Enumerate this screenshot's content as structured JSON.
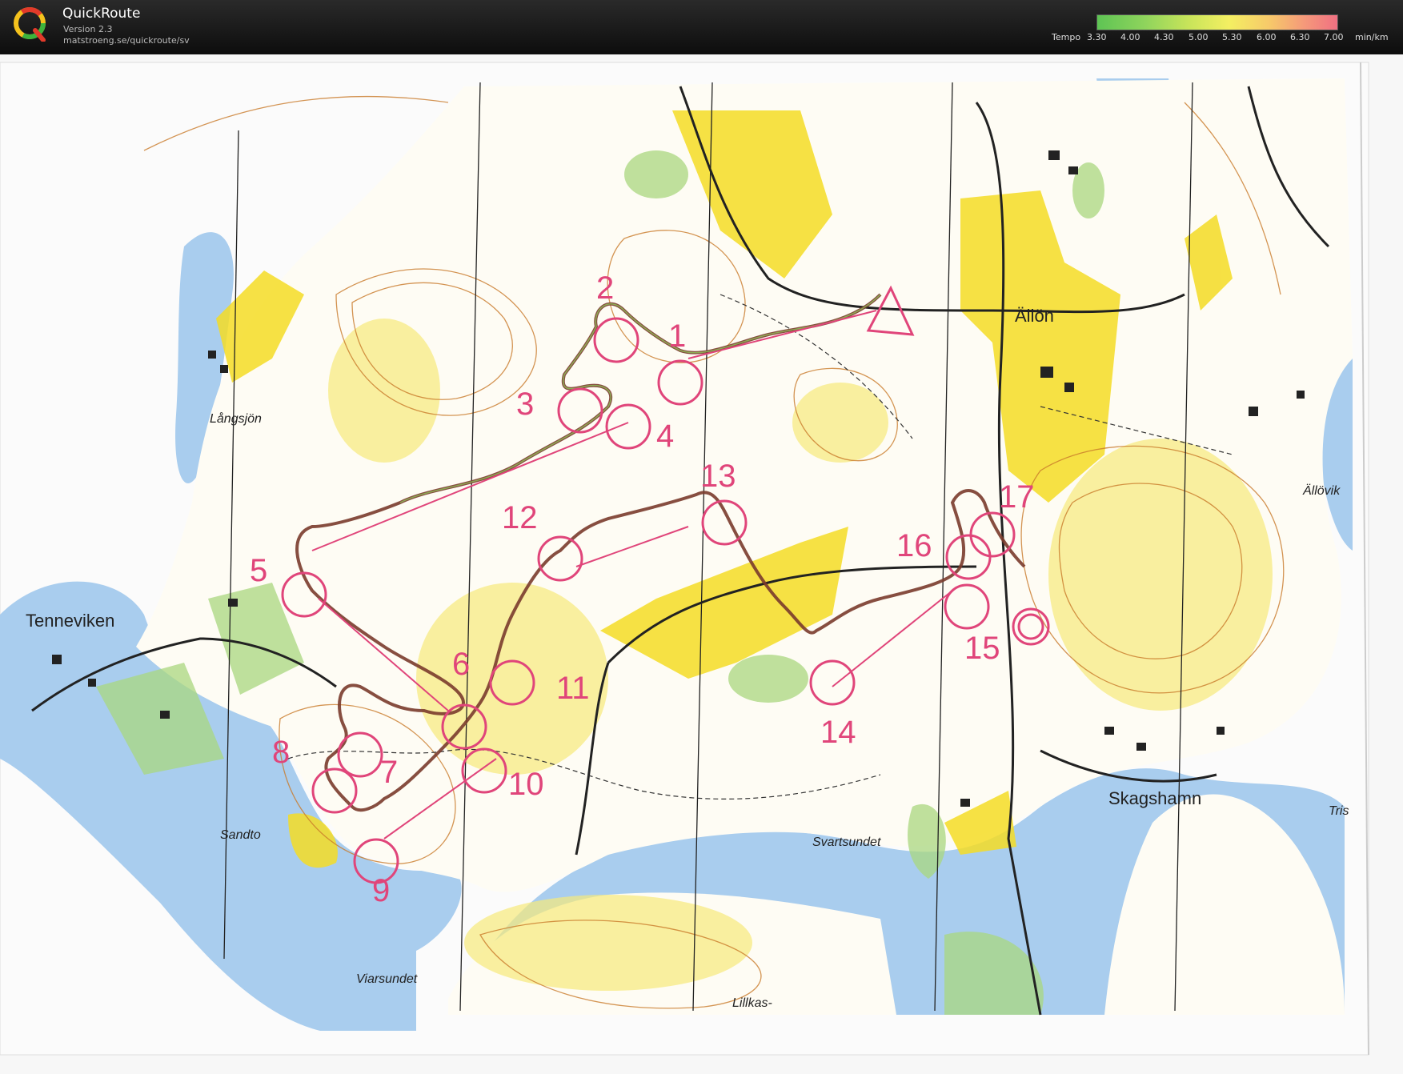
{
  "app": {
    "name": "QuickRoute",
    "version": "Version 2.3",
    "url": "matstroeng.se/quickroute/sv"
  },
  "legend": {
    "caption": "Tempo",
    "values": [
      "3.30",
      "4.00",
      "4.30",
      "5.00",
      "5.30",
      "6.00",
      "6.30",
      "7.00"
    ],
    "unit": "min/km",
    "colors": [
      "#5ec454",
      "#c8e45a",
      "#f4ef62",
      "#f59a7a",
      "#f07082"
    ]
  },
  "map": {
    "place_names": [
      "Tenneviken",
      "Långsjön",
      "Sandto",
      "Viarsundet",
      "Svartsundet",
      "Lillkas-",
      "Skagshamn",
      "Ällön",
      "Ällövik",
      "Tris"
    ],
    "control_numbers": [
      "1",
      "2",
      "3",
      "4",
      "5",
      "6",
      "7",
      "8",
      "9",
      "10",
      "11",
      "12",
      "13",
      "14",
      "15",
      "16",
      "17"
    ],
    "colors": {
      "course": "#e0457a",
      "water": "#a9cdee",
      "open_land": "#f4dc25",
      "green": "#a9d77f",
      "contour": "#c97a2a",
      "track": "#7a3b2c"
    }
  }
}
